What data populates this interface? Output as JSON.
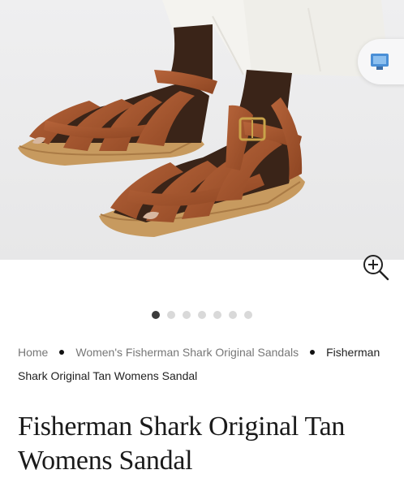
{
  "gallery": {
    "image_alt": "Fisherman Shark Original Tan Womens Sandal",
    "total_slides": 7,
    "active_slide": 1,
    "colors": {
      "leather": "#a2532a",
      "sole": "#c79a5f",
      "background": "#ececed",
      "trousers": "#f3f2ee",
      "skin": "#3a2418",
      "buckle": "#c9a34a"
    }
  },
  "icons": {
    "floating_action": "monitor-icon",
    "zoom": "zoom-in-icon"
  },
  "breadcrumb": {
    "items": [
      {
        "label": "Home"
      },
      {
        "label": "Women's Fisherman Shark Original Sandals"
      }
    ],
    "current": "Fisherman Shark Original Tan Womens Sandal"
  },
  "product": {
    "title": "Fisherman Shark Original Tan Womens Sandal"
  }
}
